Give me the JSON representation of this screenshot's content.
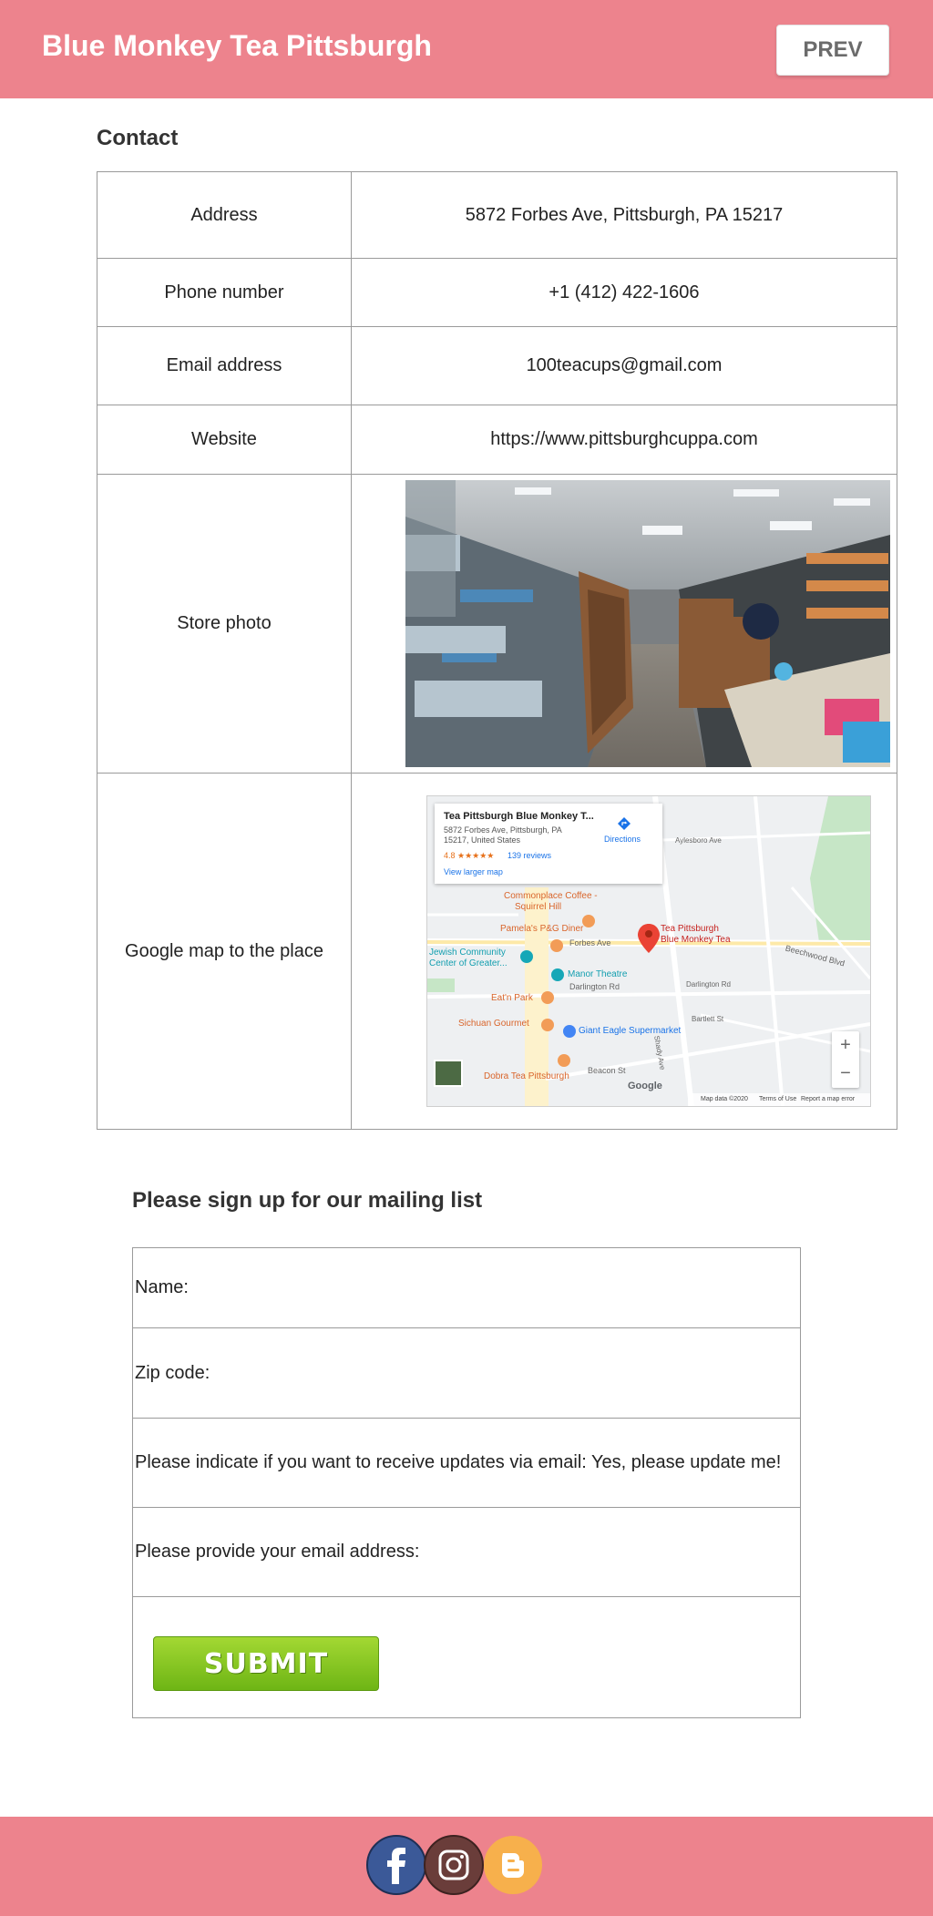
{
  "header": {
    "title": "Blue Monkey Tea Pittsburgh",
    "prev_label": "PREV"
  },
  "contact": {
    "heading": "Contact",
    "rows": [
      {
        "label": "Address",
        "value": "5872 Forbes Ave, Pittsburgh, PA 15217"
      },
      {
        "label": "Phone number",
        "value": "+1 (412) 422-1606"
      },
      {
        "label": "Email address",
        "value": "100teacups@gmail.com"
      },
      {
        "label": "Website",
        "value": "https://www.pittsburghcuppa.com"
      },
      {
        "label": "Store photo"
      },
      {
        "label": "Google map to the place"
      }
    ]
  },
  "map": {
    "place_name": "Tea Pittsburgh Blue Monkey T...",
    "place_address": "5872 Forbes Ave, Pittsburgh, PA 15217, United States",
    "rating": "4.8 ★★★★★",
    "reviews": "139 reviews",
    "directions": "Directions",
    "larger_map": "View larger map",
    "pin_label_line1": "Tea Pittsburgh",
    "pin_label_line2": "Blue Monkey Tea",
    "places": {
      "commonplace": "Commonplace Coffee -",
      "squirrel_hill": "Squirrel Hill",
      "pamelas": "Pamela's P&G Diner",
      "jcc": "Jewish Community",
      "jcc2": "Center of Greater...",
      "manor": "Manor Theatre",
      "eatn_park": "Eat'n Park",
      "sichuan": "Sichuan Gourmet",
      "giant_eagle": "Giant Eagle Supermarket",
      "dobra": "Dobra Tea Pittsburgh"
    },
    "streets": {
      "forbes": "Forbes Ave",
      "darlington": "Darlington Rd",
      "darlington2": "Darlington Rd",
      "beacon": "Beacon St",
      "shady": "Shady Ave",
      "beechwood": "Beechwood Blvd",
      "aylesboro": "Aylesboro Ave",
      "bartlett": "Bartlett St"
    },
    "brand": "Google",
    "map_data": "Map data ©2020",
    "terms": "Terms of Use",
    "report": "Report a map error",
    "zoom_in": "+",
    "zoom_out": "−"
  },
  "signup": {
    "heading": "Please sign up for our mailing list",
    "name_label": "Name:",
    "zip_label": "Zip code:",
    "updates_label": "Please indicate if you want to receive updates via email:  Yes, please update me!",
    "email_label": "Please provide your email address:",
    "submit_label": "SUBMIT"
  },
  "footer": {
    "social": [
      "facebook-icon",
      "instagram-icon",
      "blogger-icon"
    ]
  },
  "colors": {
    "brand_pink": "#ed838d",
    "submit_green": "#7cc01f"
  }
}
